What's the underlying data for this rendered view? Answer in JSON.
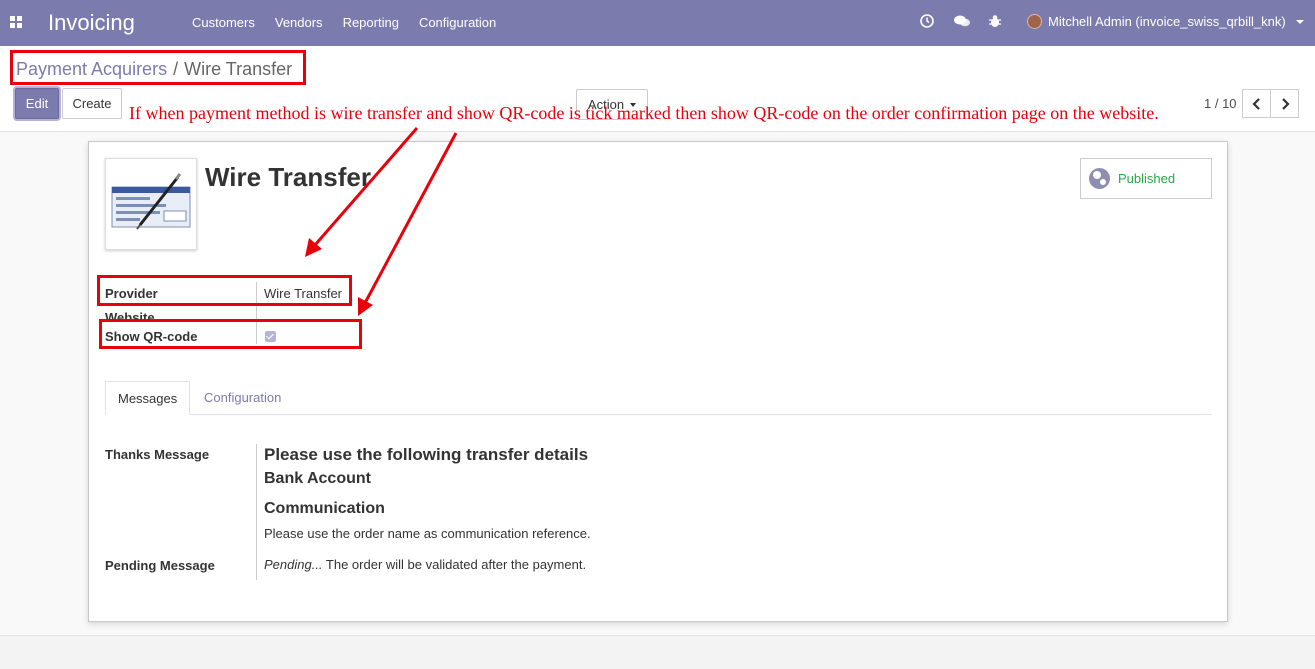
{
  "navbar": {
    "app_title": "Invoicing",
    "menu": [
      "Customers",
      "Vendors",
      "Reporting",
      "Configuration"
    ],
    "user_name": "Mitchell Admin (invoice_swiss_qrbill_knk)"
  },
  "control_panel": {
    "breadcrumb_parent": "Payment Acquirers",
    "breadcrumb_separator": "/",
    "breadcrumb_current": "Wire Transfer",
    "edit_label": "Edit",
    "create_label": "Create",
    "action_label": "Action",
    "pager": "1 / 10"
  },
  "annotation": "If when payment method is wire transfer and show QR-code is tick marked then show QR-code on the order confirmation page on the website.",
  "record": {
    "title": "Wire Transfer",
    "published_label": "Published",
    "fields": {
      "provider_label": "Provider",
      "provider_value": "Wire Transfer",
      "website_label": "Website",
      "show_qr_label": "Show QR-code",
      "show_qr_checked": true
    },
    "tabs": [
      "Messages",
      "Configuration"
    ],
    "thanks_label": "Thanks Message",
    "thanks_heading1": "Please use the following transfer details",
    "thanks_heading2": "Bank Account",
    "thanks_heading3": "Communication",
    "thanks_text": "Please use the order name as communication reference.",
    "pending_label": "Pending Message",
    "pending_em": "Pending...",
    "pending_text": " The order will be validated after the payment."
  },
  "colors": {
    "brand": "#7c7bad",
    "annotation_red": "#e8000b",
    "published_green": "#28a745"
  }
}
